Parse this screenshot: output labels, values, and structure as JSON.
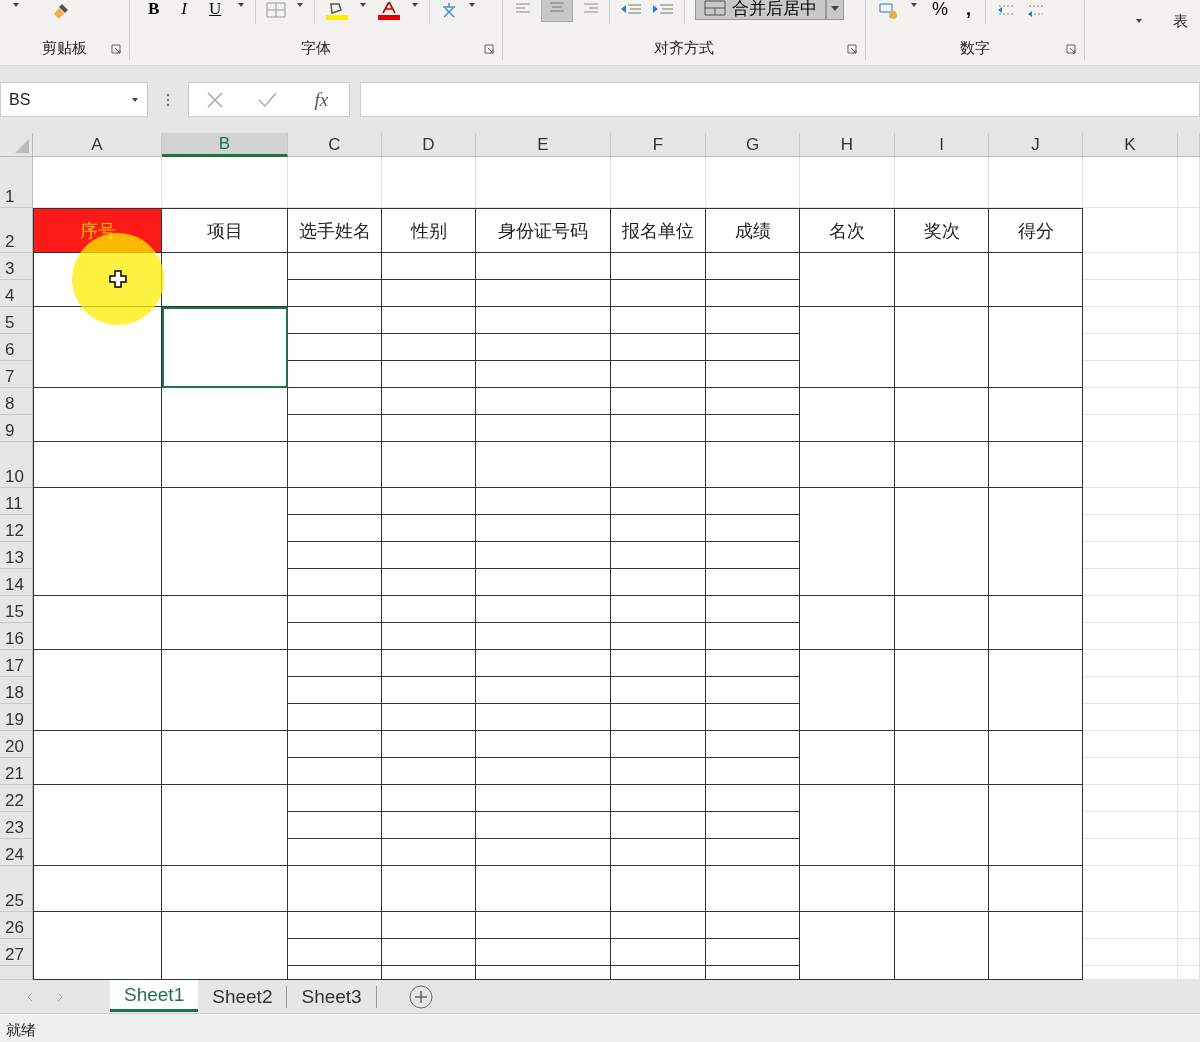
{
  "ribbon": {
    "groups": [
      {
        "label": "剪贴板"
      },
      {
        "label": "字体"
      },
      {
        "label": "对齐方式"
      },
      {
        "label": "数字"
      }
    ],
    "font_buttons": [
      "B",
      "I",
      "U"
    ],
    "merge_button": "合并后居中",
    "number_symbols": [
      "%",
      ","
    ],
    "cut_label": "表"
  },
  "formula_bar": {
    "name_box": "BS",
    "function_label": "fx"
  },
  "columns": [
    {
      "label": "A",
      "selected": false
    },
    {
      "label": "B",
      "selected": true
    },
    {
      "label": "C",
      "selected": false
    },
    {
      "label": "D",
      "selected": false
    },
    {
      "label": "E",
      "selected": false
    },
    {
      "label": "F",
      "selected": false
    },
    {
      "label": "G",
      "selected": false
    },
    {
      "label": "H",
      "selected": false
    },
    {
      "label": "I",
      "selected": false
    },
    {
      "label": "J",
      "selected": false
    },
    {
      "label": "K",
      "selected": false
    }
  ],
  "rows": [
    "1",
    "2",
    "3",
    "4",
    "5",
    "6",
    "7",
    "8",
    "9",
    "10",
    "11",
    "12",
    "13",
    "14",
    "15",
    "16",
    "17",
    "18",
    "19",
    "20",
    "21",
    "22",
    "23",
    "24",
    "25",
    "26",
    "27"
  ],
  "table": {
    "headers": [
      {
        "text": "序号",
        "highlighted": true
      },
      {
        "text": "项目",
        "highlighted": false
      },
      {
        "text": "选手姓名",
        "highlighted": false
      },
      {
        "text": "性别",
        "highlighted": false
      },
      {
        "text": "身份证号码",
        "highlighted": false
      },
      {
        "text": "报名单位",
        "highlighted": false
      },
      {
        "text": "成绩",
        "highlighted": false
      },
      {
        "text": "名次",
        "highlighted": false
      },
      {
        "text": "奖次",
        "highlighted": false
      },
      {
        "text": "得分",
        "highlighted": false
      }
    ],
    "merged_blocks": [
      {
        "selected": false
      },
      {
        "selected": true
      },
      {
        "selected": false
      },
      {
        "selected": false
      },
      {
        "selected": false
      },
      {
        "selected": false
      },
      {
        "selected": false
      },
      {
        "selected": false
      },
      {
        "selected": false
      },
      {
        "selected": false
      },
      {
        "selected": false
      }
    ]
  },
  "sheets": [
    {
      "label": "Sheet1",
      "selected": true
    },
    {
      "label": "Sheet2",
      "selected": false
    },
    {
      "label": "Sheet3",
      "selected": false
    }
  ],
  "status_bar": {
    "text": "就绪"
  }
}
